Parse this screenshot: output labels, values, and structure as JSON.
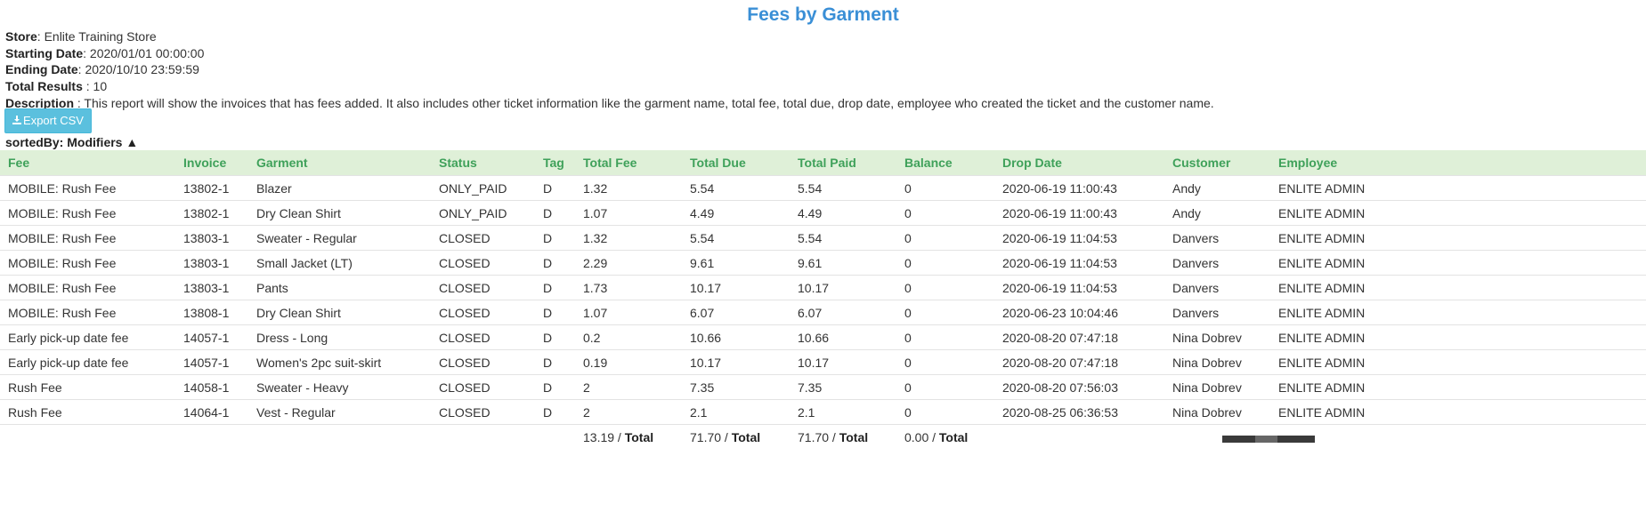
{
  "page": {
    "title": "Fees by Garment"
  },
  "meta": {
    "store_label": "Store",
    "store_value": ": Enlite Training Store",
    "start_label": "Starting Date",
    "start_value": ": 2020/01/01 00:00:00",
    "end_label": "Ending Date",
    "end_value": ": 2020/10/10 23:59:59",
    "results_label": "Total Results",
    "results_value": " : 10",
    "description_label": "Description",
    "description_value": " : This report will show the invoices that has fees added. It also includes other ticket information like the garment name, total fee, total due, drop date, employee who created the ticket and the customer name."
  },
  "toolbar": {
    "export_label": "Export CSV",
    "download_icon": "download-icon"
  },
  "sort": {
    "label": "sortedBy: Modifiers ▲"
  },
  "table": {
    "headers": [
      "Fee",
      "Invoice",
      "Garment",
      "Status",
      "Tag",
      "Total Fee",
      "Total Due",
      "Total Paid",
      "Balance",
      "Drop Date",
      "Customer",
      "Employee"
    ],
    "rows": [
      [
        "MOBILE: Rush Fee",
        "13802-1",
        "Blazer",
        "ONLY_PAID",
        "D",
        "1.32",
        "5.54",
        "5.54",
        "0",
        "2020-06-19 11:00:43",
        "Andy",
        "ENLITE ADMIN"
      ],
      [
        "MOBILE: Rush Fee",
        "13802-1",
        "Dry Clean Shirt",
        "ONLY_PAID",
        "D",
        "1.07",
        "4.49",
        "4.49",
        "0",
        "2020-06-19 11:00:43",
        "Andy",
        "ENLITE ADMIN"
      ],
      [
        "MOBILE: Rush Fee",
        "13803-1",
        "Sweater - Regular",
        "CLOSED",
        "D",
        "1.32",
        "5.54",
        "5.54",
        "0",
        "2020-06-19 11:04:53",
        "Danvers",
        "ENLITE ADMIN"
      ],
      [
        "MOBILE: Rush Fee",
        "13803-1",
        "Small Jacket (LT)",
        "CLOSED",
        "D",
        "2.29",
        "9.61",
        "9.61",
        "0",
        "2020-06-19 11:04:53",
        "Danvers",
        "ENLITE ADMIN"
      ],
      [
        "MOBILE: Rush Fee",
        "13803-1",
        "Pants",
        "CLOSED",
        "D",
        "1.73",
        "10.17",
        "10.17",
        "0",
        "2020-06-19 11:04:53",
        "Danvers",
        "ENLITE ADMIN"
      ],
      [
        "MOBILE: Rush Fee",
        "13808-1",
        "Dry Clean Shirt",
        "CLOSED",
        "D",
        "1.07",
        "6.07",
        "6.07",
        "0",
        "2020-06-23 10:04:46",
        "Danvers",
        "ENLITE ADMIN"
      ],
      [
        "Early pick-up date fee",
        "14057-1",
        "Dress - Long",
        "CLOSED",
        "D",
        "0.2",
        "10.66",
        "10.66",
        "0",
        "2020-08-20 07:47:18",
        "Nina Dobrev",
        "ENLITE ADMIN"
      ],
      [
        "Early pick-up date fee",
        "14057-1",
        "Women's 2pc suit-skirt",
        "CLOSED",
        "D",
        "0.19",
        "10.17",
        "10.17",
        "0",
        "2020-08-20 07:47:18",
        "Nina Dobrev",
        "ENLITE ADMIN"
      ],
      [
        "Rush Fee",
        "14058-1",
        "Sweater - Heavy",
        "CLOSED",
        "D",
        "2",
        "7.35",
        "7.35",
        "0",
        "2020-08-20 07:56:03",
        "Nina Dobrev",
        "ENLITE ADMIN"
      ],
      [
        "Rush Fee",
        "14064-1",
        "Vest - Regular",
        "CLOSED",
        "D",
        "2",
        "2.1",
        "2.1",
        "0",
        "2020-08-25 06:36:53",
        "Nina Dobrev",
        "ENLITE ADMIN"
      ]
    ],
    "totals": {
      "total_fee": "13.19",
      "total_due": "71.70",
      "total_paid": "71.70",
      "balance": "0.00",
      "separator": " / ",
      "word": "Total"
    }
  }
}
